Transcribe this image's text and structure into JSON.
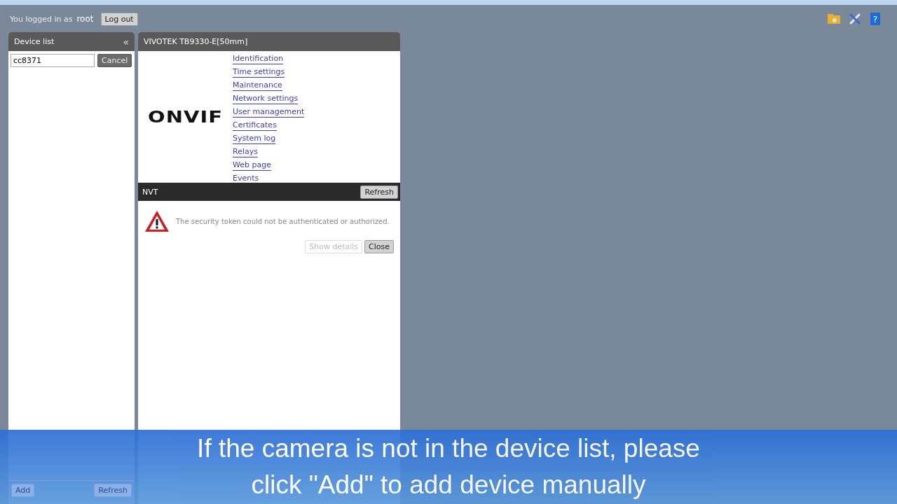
{
  "header": {
    "login_label": "You logged in as",
    "user": "root",
    "logout_button": "Log out",
    "help_icon": "?"
  },
  "device_list": {
    "title": "Device list",
    "collapse": "«",
    "search_value": "cc8371",
    "cancel_button": "Cancel",
    "add_button": "Add",
    "refresh_button": "Refresh"
  },
  "device_panel": {
    "title": "VIVOTEK TB9330-E[50mm]",
    "logo": "ONVIF",
    "links": [
      "Identification",
      "Time settings",
      "Maintenance",
      "Network settings",
      "User management",
      "Certificates",
      "System log",
      "Relays",
      "Web page",
      "Events"
    ]
  },
  "nvt": {
    "title": "NVT",
    "refresh_button": "Refresh",
    "error_message": "The security token could not be authenticated or authorized.",
    "buttons": [
      {
        "label": "Show details",
        "disabled": true
      },
      {
        "label": "Close",
        "disabled": false
      }
    ]
  },
  "subtitle": [
    "If the camera is not in the device list, please",
    "click \"Add\" to add device manually"
  ]
}
